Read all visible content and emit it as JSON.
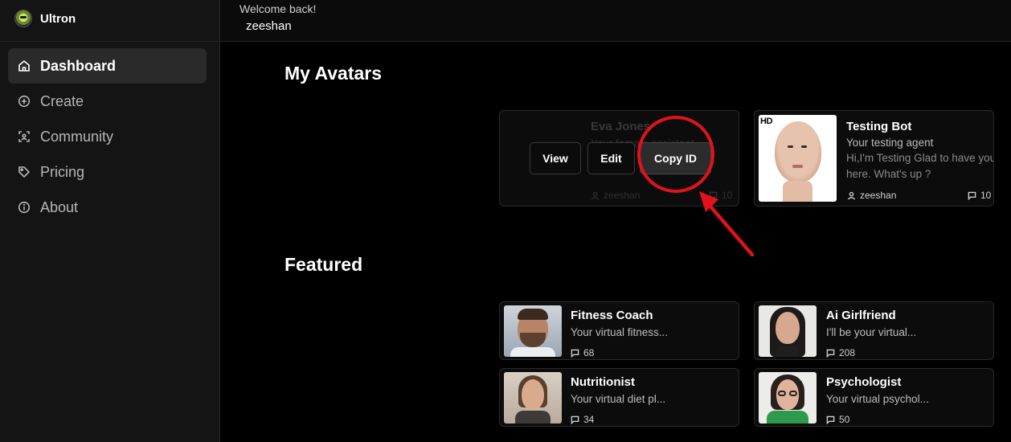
{
  "app": {
    "name": "Ultron"
  },
  "sidebar": {
    "items": [
      {
        "label": "Dashboard",
        "icon": "home-icon",
        "active": true
      },
      {
        "label": "Create",
        "icon": "plus-circle-icon",
        "active": false
      },
      {
        "label": "Community",
        "icon": "scan-face-icon",
        "active": false
      },
      {
        "label": "Pricing",
        "icon": "tag-icon",
        "active": false
      },
      {
        "label": "About",
        "icon": "info-icon",
        "active": false
      }
    ]
  },
  "header": {
    "welcome": "Welcome back!",
    "username": "zeeshan"
  },
  "my_avatars": {
    "title": "My Avatars",
    "cards": [
      {
        "name": "Eva Jones",
        "desc": "Your female assistant",
        "author": "zeeshan",
        "count": "10",
        "actions": {
          "view": "View",
          "edit": "Edit",
          "copy_id": "Copy ID"
        }
      },
      {
        "name": "Testing Bot",
        "desc": "Your testing agent",
        "greeting": "Hi,I'm Testing Glad to have you here. What's up ?",
        "author": "zeeshan",
        "count": "10",
        "badge": "HD"
      }
    ]
  },
  "featured": {
    "title": "Featured",
    "cards": [
      {
        "name": "Fitness Coach",
        "desc": "Your virtual fitness...",
        "count": "68"
      },
      {
        "name": "Ai Girlfriend",
        "desc": "I'll be your virtual...",
        "count": "208"
      },
      {
        "name": "Nutritionist",
        "desc": "Your virtual diet pl...",
        "count": "34"
      },
      {
        "name": "Psychologist",
        "desc": "Your virtual psychol...",
        "count": "50"
      }
    ]
  },
  "colors": {
    "annotation": "#e3111b",
    "background": "#000000",
    "sidebar": "#141414"
  }
}
